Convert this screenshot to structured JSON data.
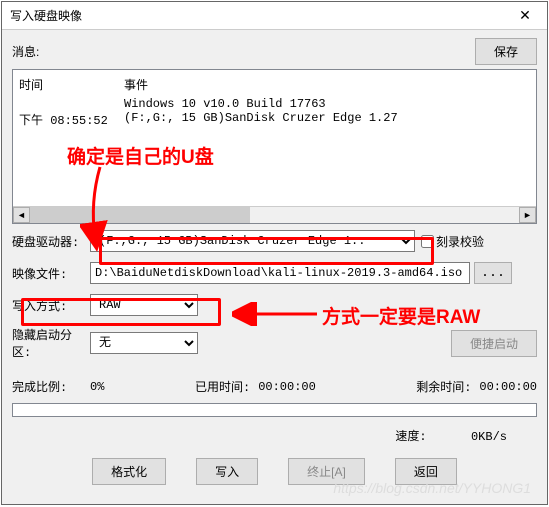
{
  "title": "写入硬盘映像",
  "close": "✕",
  "msg_label": "消息:",
  "save_btn": "保存",
  "log": {
    "h_time": "时间",
    "h_event": "事件",
    "rows": [
      {
        "time": "",
        "event": "Windows 10 v10.0 Build 17763"
      },
      {
        "time": "下午 08:55:52",
        "event": "(F:,G:, 15 GB)SanDisk Cruzer Edge     1.27"
      }
    ]
  },
  "labels": {
    "drive": "硬盘驱动器:",
    "image": "映像文件:",
    "method": "写入方式:",
    "hidden": "隐藏启动分区:",
    "progress_pct": "完成比例:",
    "elapsed": "已用时间:",
    "remain": "剩余时间:",
    "speed": "速度:"
  },
  "values": {
    "drive_option": "(F:,G:, 15 GB)SanDisk Cruzer Edge     1.: ",
    "verify": "刻录校验",
    "image_path": "D:\\BaiduNetdiskDownload\\kali-linux-2019.3-amd64.iso",
    "method": "RAW",
    "hidden": "无",
    "pct": "0%",
    "elapsed": "00:00:00",
    "remain": "00:00:00",
    "speed": "0KB/s"
  },
  "buttons": {
    "convenient": "便捷启动",
    "format": "格式化",
    "write": "写入",
    "abort": "终止[A]",
    "back": "返回",
    "browse": "..."
  },
  "annotations": {
    "a1": "确定是自己的U盘",
    "a2": "方式一定要是RAW"
  },
  "watermark": "https://blog.csdn.net/YYHONG1",
  "scroll": {
    "left": "◄",
    "right": "►"
  }
}
